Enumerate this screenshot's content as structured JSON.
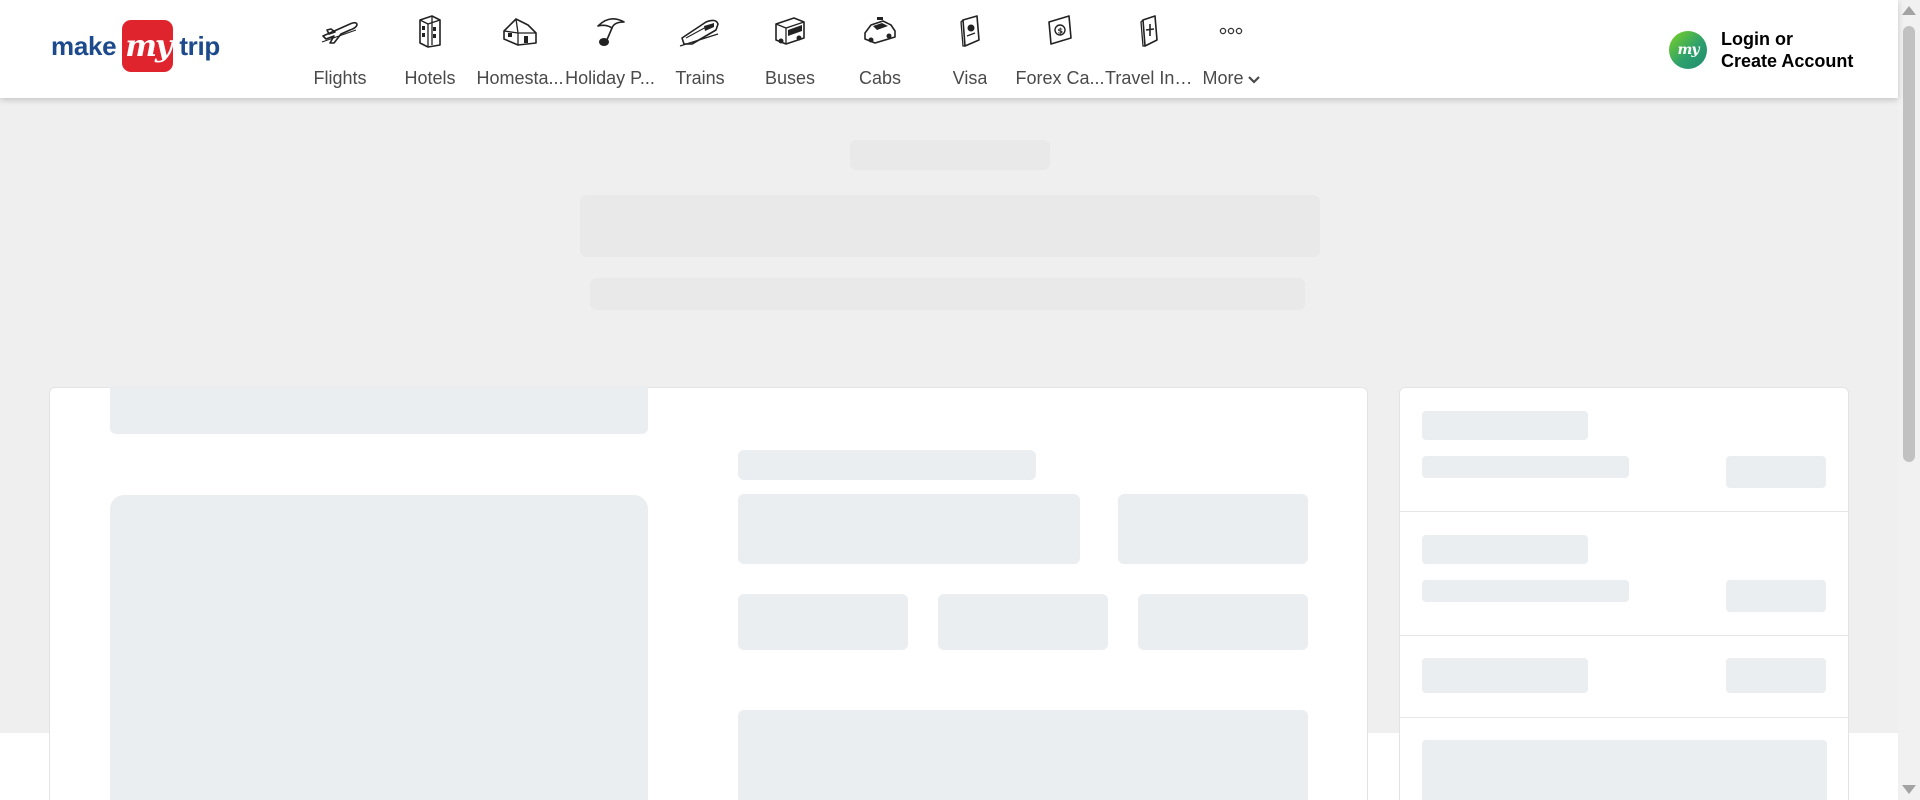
{
  "brand": {
    "logo_left": "make",
    "logo_mid": "my",
    "logo_right": "trip"
  },
  "nav": {
    "items": [
      {
        "label": "Flights",
        "icon": "plane-icon"
      },
      {
        "label": "Hotels",
        "icon": "hotel-building-icon"
      },
      {
        "label": "Homesta...",
        "icon": "homestay-house-icon"
      },
      {
        "label": "Holiday P...",
        "icon": "holiday-umbrella-icon"
      },
      {
        "label": "Trains",
        "icon": "train-icon"
      },
      {
        "label": "Buses",
        "icon": "bus-icon"
      },
      {
        "label": "Cabs",
        "icon": "cab-icon"
      },
      {
        "label": "Visa",
        "icon": "visa-passport-icon"
      },
      {
        "label": "Forex Ca...",
        "icon": "forex-card-icon"
      },
      {
        "label": "Travel Ins...",
        "icon": "travel-insurance-icon"
      }
    ],
    "more_label": "More",
    "more_icon": "more-dots-icon"
  },
  "account": {
    "avatar_text": "my",
    "login_line1": "Login or",
    "login_line2": "Create Account"
  },
  "colors": {
    "brand_blue": "#1c4a8c",
    "brand_red": "#e0242e",
    "skeleton": "#ebeef1",
    "page_bg": "#efefef"
  }
}
